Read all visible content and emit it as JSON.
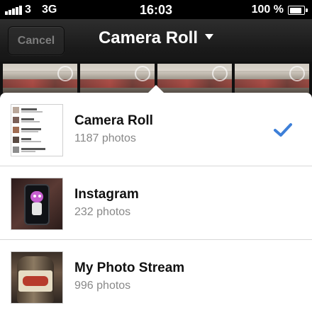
{
  "status_bar": {
    "carrier": "3",
    "network": "3G",
    "time": "16:03",
    "battery": "100 %",
    "battery_level": 1.0
  },
  "nav": {
    "cancel_label": "Cancel",
    "title": "Camera Roll"
  },
  "albums": [
    {
      "name": "Camera Roll",
      "count": "1187 photos",
      "selected": true
    },
    {
      "name": "Instagram",
      "count": "232 photos",
      "selected": false
    },
    {
      "name": "My Photo Stream",
      "count": "996 photos",
      "selected": false
    }
  ],
  "colors": {
    "accent_check": "#3d7fd8",
    "nav_background": "#1e1e1e",
    "count_text": "#888888"
  }
}
